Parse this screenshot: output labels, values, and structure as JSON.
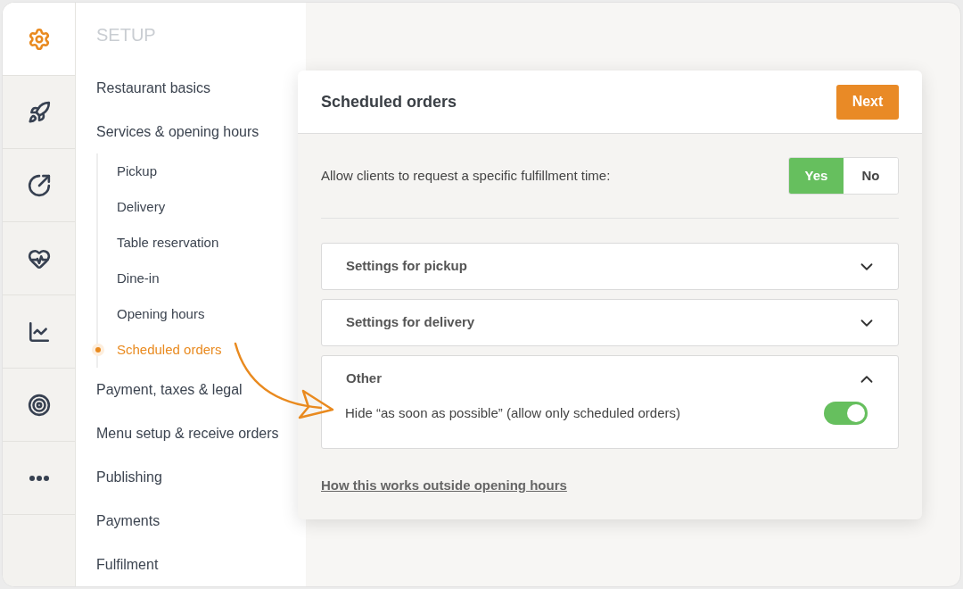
{
  "rail": [
    {
      "selected": true
    },
    {
      "selected": false
    },
    {
      "selected": false
    },
    {
      "selected": false
    },
    {
      "selected": false
    },
    {
      "selected": false
    },
    {
      "selected": false
    }
  ],
  "nav": {
    "title": "SETUP",
    "items": [
      {
        "label": "Restaurant basics",
        "selected": false
      },
      {
        "label": "Services & opening hours",
        "selected": false,
        "children": [
          {
            "label": "Pickup",
            "selected": false
          },
          {
            "label": "Delivery",
            "selected": false
          },
          {
            "label": "Table reservation",
            "selected": false
          },
          {
            "label": "Dine-in",
            "selected": false
          },
          {
            "label": "Opening hours",
            "selected": false
          },
          {
            "label": "Scheduled orders",
            "selected": true
          }
        ]
      },
      {
        "label": "Payment, taxes & legal",
        "selected": false
      },
      {
        "label": "Menu setup & receive orders",
        "selected": false
      },
      {
        "label": "Publishing",
        "selected": false
      },
      {
        "label": "Payments",
        "selected": false
      },
      {
        "label": "Fulfilment",
        "selected": false
      }
    ]
  },
  "card": {
    "title": "Scheduled orders",
    "next_button": "Next",
    "question": {
      "label": "Allow clients to request a specific fulfillment time:",
      "options": [
        {
          "label": "Yes",
          "selected": true
        },
        {
          "label": "No",
          "selected": false
        }
      ]
    },
    "sections": [
      {
        "title": "Settings for pickup",
        "expanded": false
      },
      {
        "title": "Settings for delivery",
        "expanded": false
      },
      {
        "title": "Other",
        "expanded": true,
        "setting": {
          "label": "Hide “as soon as possible” (allow only scheduled orders)",
          "on": true
        }
      }
    ],
    "link": "How this works outside opening hours"
  }
}
